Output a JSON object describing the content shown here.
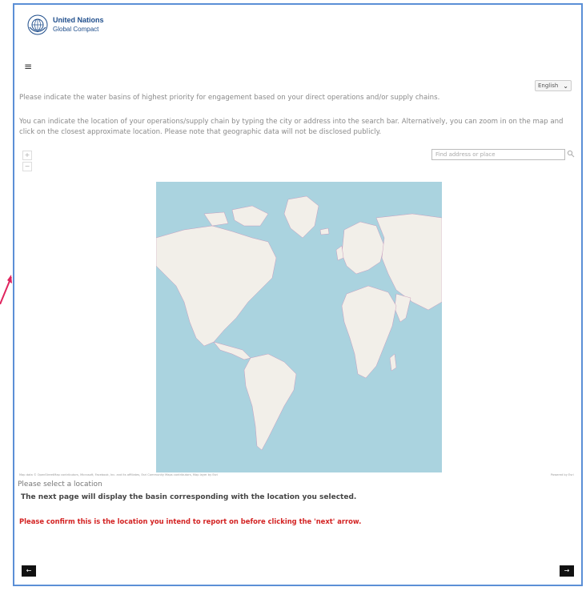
{
  "header": {
    "org_line1": "United Nations",
    "org_line2": "Global Compact"
  },
  "language": {
    "selected": "English"
  },
  "instructions": {
    "line1": "Please indicate the water basins of highest priority for engagement based on your direct operations and/or supply chains.",
    "line2": "You can indicate the location of your operations/supply chain by typing the city or address into the search bar. Alternatively, you can zoom in on the map and click on the closest approximate location. Please note that geographic data will not be disclosed publicly."
  },
  "map": {
    "zoom_in": "+",
    "zoom_out": "−",
    "search_placeholder": "Find address or place",
    "attribution": "Map data © OpenStreetMap contributors, Microsoft, Facebook, Inc. and its affiliates, Esri Community Maps contributors, Map layer by Esri",
    "powered_by": "Powered by Esri",
    "water_color": "#aad3df",
    "land_color": "#f2efe9",
    "border_color": "#c48bb5"
  },
  "selection": {
    "status": "Please select a location",
    "next_info": "The next page will display the basin corresponding with the location you selected.",
    "confirm_warning": "Please confirm this is the location you intend to report on before clicking the 'next' arrow."
  },
  "nav": {
    "prev": "←",
    "next": "→"
  },
  "colors": {
    "frame": "#5b8fd6",
    "warning": "#d32222",
    "nav_button": "#111111"
  }
}
